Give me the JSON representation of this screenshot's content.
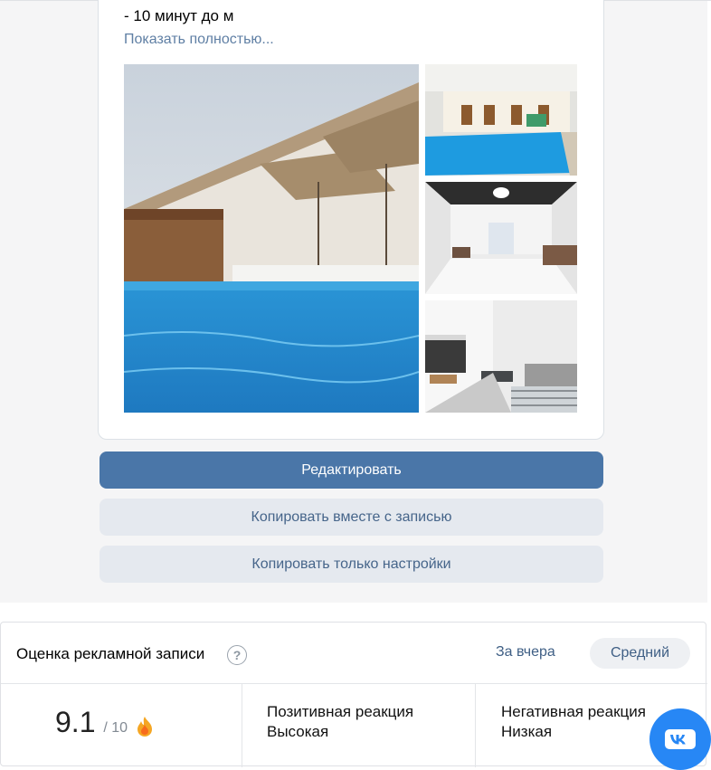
{
  "post": {
    "text_line": "- 10 минут до м",
    "show_more": "Показать полностью..."
  },
  "photos": [
    {
      "name": "pool-umbrellas-photo"
    },
    {
      "name": "pool-courtyard-photo"
    },
    {
      "name": "living-room-photo"
    },
    {
      "name": "bedroom-kitchen-photo"
    }
  ],
  "actions": {
    "edit": "Редактировать",
    "copy_with_post": "Копировать вместе с записью",
    "copy_settings_only": "Копировать только настройки"
  },
  "rating": {
    "title": "Оценка рекламной записи",
    "help": "?",
    "period": "За вчера",
    "level": "Средний",
    "score": "9.1",
    "score_max": "/ 10",
    "positive_label": "Позитивная реакция",
    "positive_value": "Высокая",
    "negative_label": "Негативная реакция",
    "negative_value": "Низкая"
  },
  "icons": {
    "fire": "fire-icon",
    "help": "question-icon",
    "vk": "vk-logo-icon"
  },
  "colors": {
    "primary": "#4a76a8",
    "secondary": "#e5e9ef",
    "link": "#5f7fa4",
    "vk_blue": "#2787f5"
  }
}
